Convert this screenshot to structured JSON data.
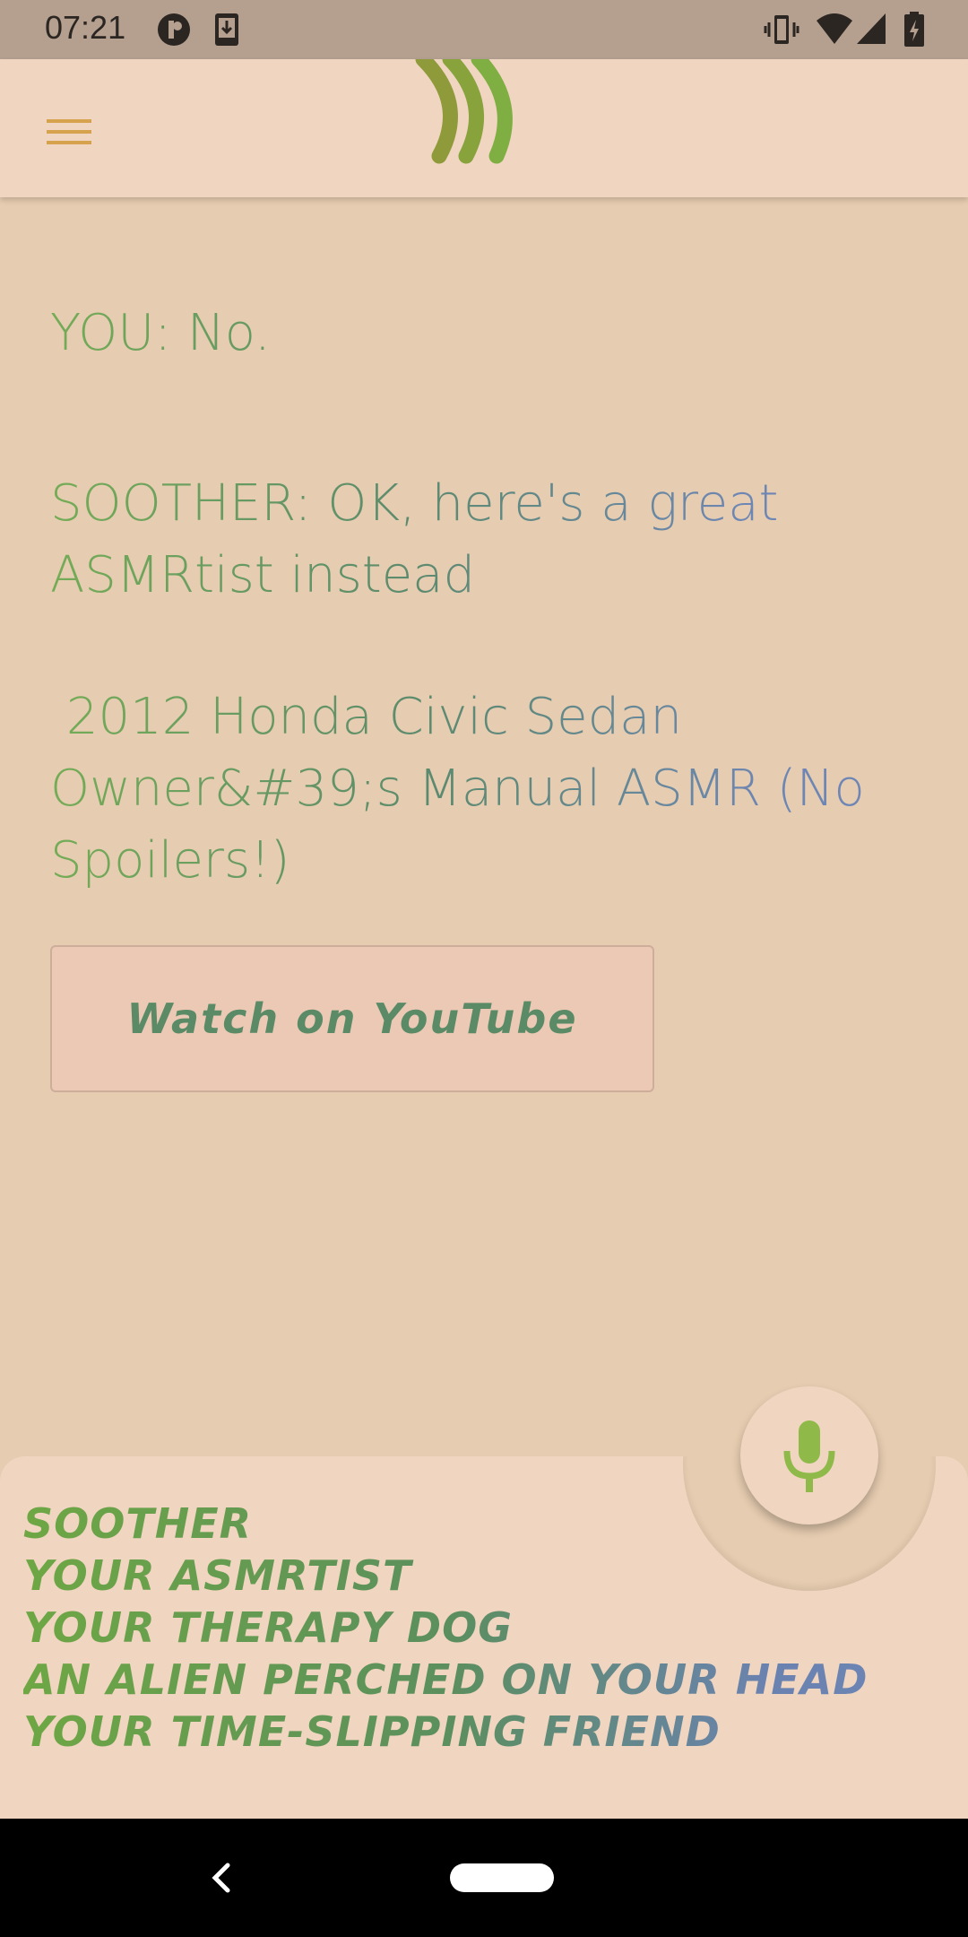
{
  "status_bar": {
    "time": "07:21",
    "icons": [
      "app-icon",
      "download-icon",
      "vibrate-icon",
      "wifi-icon",
      "signal-icon",
      "battery-charging-icon"
    ]
  },
  "app_bar": {
    "menu_icon": "hamburger-menu-icon",
    "logo": "soother-logo",
    "colors": {
      "menu": "#d6a24e",
      "logo_dark": "#8f9a3a",
      "logo_light": "#7fae42"
    }
  },
  "chat": {
    "messages": [
      {
        "text": "YOU: No."
      },
      {
        "text": "SOOTHER: OK, here's a great ASMRtist instead"
      },
      {
        "text": " 2012 Honda Civic Sedan Owner&#39;s Manual ASMR (No Spoilers!)"
      }
    ],
    "youtube_button_label": "Watch on YouTube"
  },
  "mic": {
    "icon": "microphone-icon",
    "color": "#8fba4a"
  },
  "roles": {
    "lines": [
      "SOOTHER",
      "YOUR ASMRTIST",
      "YOUR THERAPY DOG",
      "AN ALIEN PERCHED ON YOUR HEAD",
      "YOUR TIME-SLIPPING FRIEND"
    ]
  },
  "nav": {
    "back_icon": "back-chevron-icon",
    "home_icon": "home-pill-icon"
  },
  "colors": {
    "background": "#e6ccb0",
    "panel": "#f0d5c0",
    "text_green": "#74ac56",
    "text_blue": "#6f86b6"
  }
}
